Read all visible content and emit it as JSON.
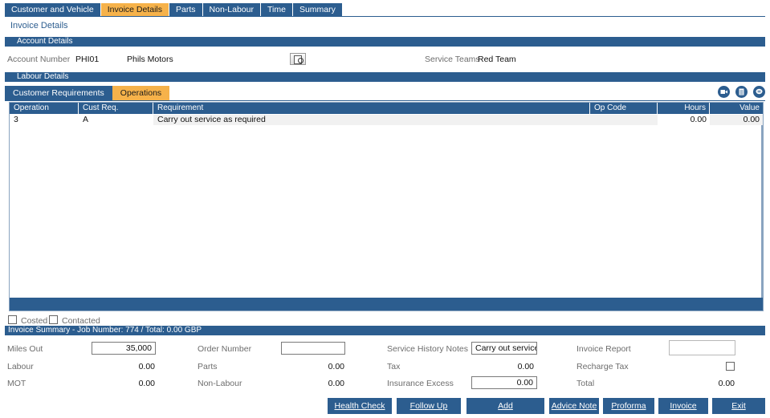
{
  "top_tabs": [
    "Customer and Vehicle",
    "Invoice Details",
    "Parts",
    "Non-Labour",
    "Time",
    "Summary"
  ],
  "active_top_tab": "Invoice Details",
  "page_title": "Invoice Details",
  "account_section": {
    "title": "Account Details",
    "account_number_label": "Account Number",
    "account_number": "PHI01",
    "account_name": "Phils Motors",
    "service_teams_label": "Service Teams",
    "service_teams": "Red Team"
  },
  "labour_section": {
    "title": "Labour Details",
    "sub_tabs": [
      "Customer Requirements",
      "Operations"
    ],
    "active_sub_tab": "Operations",
    "icons": [
      "video-icon",
      "document-icon",
      "chat-icon"
    ]
  },
  "grid": {
    "columns": [
      "Operation",
      "Cust Req.",
      "Requirement",
      "Op Code",
      "Hours",
      "Value"
    ],
    "rows": [
      {
        "operation": "3",
        "cust_req": "A",
        "requirement": "Carry out service as required",
        "op_code": "",
        "hours": "0.00",
        "value": "0.00"
      }
    ]
  },
  "flags": {
    "costed_label": "Costed",
    "contacted_label": "Contacted"
  },
  "summary": {
    "title": "Invoice Summary - Job Number: 774 / Total: 0.00 GBP",
    "miles_out_label": "Miles Out",
    "miles_out": "35,000",
    "order_number_label": "Order Number",
    "order_number": "",
    "service_history_label": "Service History Notes",
    "service_history_notes": "Carry out service a",
    "invoice_report_label": "Invoice Report",
    "invoice_report": "",
    "labour_label": "Labour",
    "labour": "0.00",
    "parts_label": "Parts",
    "parts": "0.00",
    "tax_label": "Tax",
    "tax": "0.00",
    "recharge_tax_label": "Recharge Tax",
    "mot_label": "MOT",
    "mot": "0.00",
    "non_labour_label": "Non-Labour",
    "non_labour": "0.00",
    "insurance_excess_label": "Insurance Excess",
    "insurance_excess": "0.00",
    "total_label": "Total",
    "total": "0.00"
  },
  "buttons": {
    "health_check": "Health Check",
    "follow_up": "Follow Up",
    "add": "Add",
    "advice_note": "Advice Note",
    "proforma": "Proforma",
    "invoice": "Invoice",
    "exit": "Exit"
  },
  "colors": {
    "primary": "#2c5d8f",
    "active_tab": "#f6b24a"
  }
}
